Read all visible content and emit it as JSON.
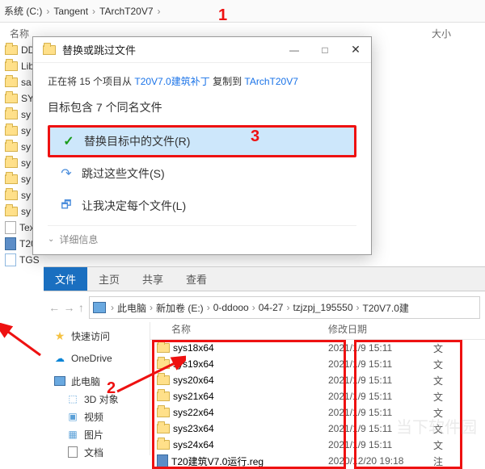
{
  "top_breadcrumb": {
    "parts": [
      "系统 (C:)",
      "Tangent",
      "TArchT20V7"
    ]
  },
  "headers_top": {
    "name": "名称",
    "size": "大小"
  },
  "left_items": [
    {
      "type": "folder",
      "label": "DD"
    },
    {
      "type": "folder",
      "label": "Lib"
    },
    {
      "type": "folder",
      "label": "sa"
    },
    {
      "type": "folder",
      "label": "SY"
    },
    {
      "type": "folder",
      "label": "sy"
    },
    {
      "type": "folder",
      "label": "sy"
    },
    {
      "type": "folder",
      "label": "sy"
    },
    {
      "type": "folder",
      "label": "sy"
    },
    {
      "type": "folder",
      "label": "sy"
    },
    {
      "type": "folder",
      "label": "sy"
    },
    {
      "type": "folder",
      "label": "sy"
    },
    {
      "type": "txt",
      "label": "Tex"
    },
    {
      "type": "reg",
      "label": "T20"
    },
    {
      "type": "file",
      "label": "TGS"
    }
  ],
  "dialog": {
    "title": "替换或跳过文件",
    "copy_prefix": "正在将 15 个项目从 ",
    "copy_src": "T20V7.0建筑补丁",
    "copy_mid": " 复制到 ",
    "copy_dst": "TArchT20V7",
    "contains": "目标包含 7 个同名文件",
    "opt_replace": "替换目标中的文件(R)",
    "opt_skip": "跳过这些文件(S)",
    "opt_decide": "让我决定每个文件(L)",
    "detail": "详细信息"
  },
  "explorer2": {
    "tabs": [
      "文件",
      "主页",
      "共享",
      "查看"
    ],
    "crumb": [
      "此电脑",
      "新加卷 (E:)",
      "0-ddooo",
      "04-27",
      "tzjzpj_195550",
      "T20V7.0建"
    ],
    "head_name": "名称",
    "head_date": "修改日期",
    "sidebar": [
      {
        "icon": "star",
        "label": "快速访问"
      },
      {
        "icon": "cloud",
        "label": "OneDrive"
      },
      {
        "icon": "pc",
        "label": "此电脑"
      },
      {
        "icon": "obj3d",
        "label": "3D 对象"
      },
      {
        "icon": "vid",
        "label": "视频"
      },
      {
        "icon": "pic",
        "label": "图片"
      },
      {
        "icon": "doc",
        "label": "文档"
      }
    ],
    "files": [
      {
        "icon": "folder",
        "name": "sys18x64",
        "date": "2021/1/9 15:11",
        "type": "文"
      },
      {
        "icon": "folder",
        "name": "sys19x64",
        "date": "2021/1/9 15:11",
        "type": "文"
      },
      {
        "icon": "folder",
        "name": "sys20x64",
        "date": "2021/1/9 15:11",
        "type": "文"
      },
      {
        "icon": "folder",
        "name": "sys21x64",
        "date": "2021/1/9 15:11",
        "type": "文"
      },
      {
        "icon": "folder",
        "name": "sys22x64",
        "date": "2021/1/9 15:11",
        "type": "文"
      },
      {
        "icon": "folder",
        "name": "sys23x64",
        "date": "2021/1/9 15:11",
        "type": "文"
      },
      {
        "icon": "folder",
        "name": "sys24x64",
        "date": "2021/1/9 15:11",
        "type": "文"
      },
      {
        "icon": "reg",
        "name": "T20建筑V7.0运行.reg",
        "date": "2020/12/20 19:18",
        "type": "注"
      }
    ]
  },
  "anno": {
    "n1": "1",
    "n2": "2",
    "n3": "3"
  },
  "wm_side": "当下软件园"
}
